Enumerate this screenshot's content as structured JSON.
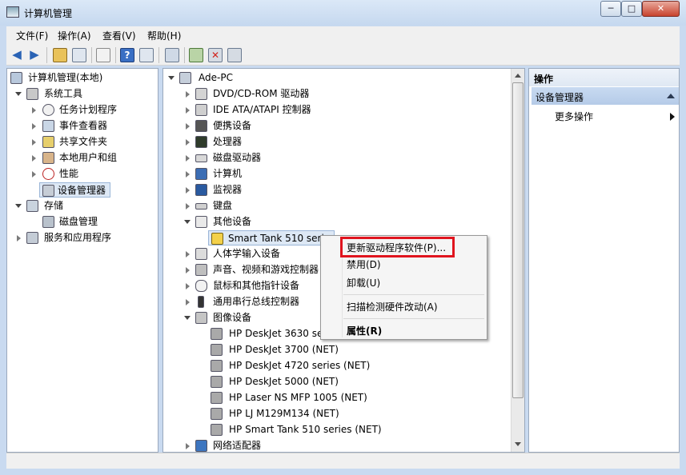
{
  "window": {
    "title": "计算机管理",
    "btn_min": "─",
    "btn_max": "□",
    "btn_close": "✕"
  },
  "menu": [
    "文件(F)",
    "操作(A)",
    "查看(V)",
    "帮助(H)"
  ],
  "left_tree": [
    {
      "label": "计算机管理(本地)",
      "icon": "computer-management-icon"
    },
    {
      "label": "系统工具",
      "icon": "tools-icon"
    },
    {
      "label": "任务计划程序",
      "icon": "clock-icon"
    },
    {
      "label": "事件查看器",
      "icon": "event-viewer-icon"
    },
    {
      "label": "共享文件夹",
      "icon": "shared-folder-icon"
    },
    {
      "label": "本地用户和组",
      "icon": "users-icon"
    },
    {
      "label": "性能",
      "icon": "performance-icon"
    },
    {
      "label": "设备管理器",
      "icon": "device-manager-icon"
    },
    {
      "label": "存储",
      "icon": "storage-icon"
    },
    {
      "label": "磁盘管理",
      "icon": "disk-management-icon"
    },
    {
      "label": "服务和应用程序",
      "icon": "services-icon"
    }
  ],
  "device_tree": [
    {
      "label": "Ade-PC",
      "icon": "computer-icon"
    },
    {
      "label": "DVD/CD-ROM 驱动器",
      "icon": "dvd-icon"
    },
    {
      "label": "IDE ATA/ATAPI 控制器",
      "icon": "ide-icon"
    },
    {
      "label": "便携设备",
      "icon": "portable-icon"
    },
    {
      "label": "处理器",
      "icon": "cpu-icon"
    },
    {
      "label": "磁盘驱动器",
      "icon": "disk-icon"
    },
    {
      "label": "计算机",
      "icon": "computer-icon"
    },
    {
      "label": "监视器",
      "icon": "monitor-icon"
    },
    {
      "label": "键盘",
      "icon": "keyboard-icon"
    },
    {
      "label": "其他设备",
      "icon": "other-devices-icon"
    },
    {
      "label": "Smart Tank 510 series",
      "icon": "warning-device-icon"
    },
    {
      "label": "人体学输入设备",
      "icon": "hid-icon"
    },
    {
      "label": "声音、视频和游戏控制器",
      "icon": "sound-icon"
    },
    {
      "label": "鼠标和其他指针设备",
      "icon": "mouse-icon"
    },
    {
      "label": "通用串行总线控制器",
      "icon": "usb-icon"
    },
    {
      "label": "图像设备",
      "icon": "imaging-icon"
    },
    {
      "label": "HP DeskJet 3630 series (NET)",
      "icon": "printer-icon"
    },
    {
      "label": "HP DeskJet 3700 (NET)",
      "icon": "printer-icon"
    },
    {
      "label": "HP DeskJet 4720 series (NET)",
      "icon": "printer-icon"
    },
    {
      "label": "HP DeskJet 5000 (NET)",
      "icon": "printer-icon"
    },
    {
      "label": "HP Laser NS MFP 1005 (NET)",
      "icon": "printer-icon"
    },
    {
      "label": "HP LJ M129M134 (NET)",
      "icon": "printer-icon"
    },
    {
      "label": "HP Smart Tank 510 series (NET)",
      "icon": "printer-icon"
    },
    {
      "label": "网络适配器",
      "icon": "network-icon"
    }
  ],
  "actions": {
    "title": "操作",
    "section": "设备管理器",
    "more": "更多操作"
  },
  "context_menu": {
    "update_driver": "更新驱动程序软件(P)...",
    "disable": "禁用(D)",
    "uninstall": "卸载(U)",
    "scan": "扫描检测硬件改动(A)",
    "properties": "属性(R)"
  },
  "colors": {
    "highlight_box": "#e0141e",
    "selection": "#dde8f5"
  }
}
